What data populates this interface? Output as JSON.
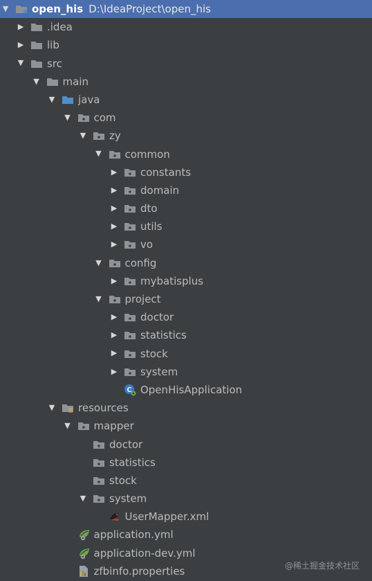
{
  "project": {
    "name": "open_his",
    "path": "D:\\IdeaProject\\open_his"
  },
  "tree": [
    {
      "label": ".idea",
      "name": "tree-item-idea",
      "indent": 0,
      "expanded": false,
      "icon": "folder-icon"
    },
    {
      "label": "lib",
      "name": "tree-item-lib",
      "indent": 0,
      "expanded": false,
      "icon": "folder-icon"
    },
    {
      "label": "src",
      "name": "tree-item-src",
      "indent": 0,
      "expanded": true,
      "icon": "folder-icon"
    },
    {
      "label": "main",
      "name": "tree-item-main",
      "indent": 1,
      "expanded": true,
      "icon": "folder-icon"
    },
    {
      "label": "java",
      "name": "tree-item-java",
      "indent": 2,
      "expanded": true,
      "icon": "source-folder-icon"
    },
    {
      "label": "com",
      "name": "tree-item-com",
      "indent": 3,
      "expanded": true,
      "icon": "package-icon"
    },
    {
      "label": "zy",
      "name": "tree-item-zy",
      "indent": 4,
      "expanded": true,
      "icon": "package-icon"
    },
    {
      "label": "common",
      "name": "tree-item-common",
      "indent": 5,
      "expanded": true,
      "icon": "package-icon"
    },
    {
      "label": "constants",
      "name": "tree-item-constants",
      "indent": 6,
      "expanded": false,
      "icon": "package-icon"
    },
    {
      "label": "domain",
      "name": "tree-item-domain",
      "indent": 6,
      "expanded": false,
      "icon": "package-icon"
    },
    {
      "label": "dto",
      "name": "tree-item-dto",
      "indent": 6,
      "expanded": false,
      "icon": "package-icon"
    },
    {
      "label": "utils",
      "name": "tree-item-utils",
      "indent": 6,
      "expanded": false,
      "icon": "package-icon"
    },
    {
      "label": "vo",
      "name": "tree-item-vo",
      "indent": 6,
      "expanded": false,
      "icon": "package-icon"
    },
    {
      "label": "config",
      "name": "tree-item-config",
      "indent": 5,
      "expanded": true,
      "icon": "package-icon"
    },
    {
      "label": "mybatisplus",
      "name": "tree-item-mybatisplus",
      "indent": 6,
      "expanded": false,
      "icon": "package-icon"
    },
    {
      "label": "project",
      "name": "tree-item-project",
      "indent": 5,
      "expanded": true,
      "icon": "package-icon"
    },
    {
      "label": "doctor",
      "name": "tree-item-project-doctor",
      "indent": 6,
      "expanded": false,
      "icon": "package-icon"
    },
    {
      "label": "statistics",
      "name": "tree-item-project-statistics",
      "indent": 6,
      "expanded": false,
      "icon": "package-icon"
    },
    {
      "label": "stock",
      "name": "tree-item-project-stock",
      "indent": 6,
      "expanded": false,
      "icon": "package-icon"
    },
    {
      "label": "system",
      "name": "tree-item-project-system",
      "indent": 6,
      "expanded": false,
      "icon": "package-icon"
    },
    {
      "label": "OpenHisApplication",
      "name": "tree-item-openhisapplication",
      "indent": 6,
      "expanded": null,
      "icon": "spring-boot-class-icon"
    },
    {
      "label": "resources",
      "name": "tree-item-resources",
      "indent": 2,
      "expanded": true,
      "icon": "resources-folder-icon"
    },
    {
      "label": "mapper",
      "name": "tree-item-mapper",
      "indent": 3,
      "expanded": true,
      "icon": "package-icon"
    },
    {
      "label": "doctor",
      "name": "tree-item-mapper-doctor",
      "indent": 4,
      "expanded": null,
      "icon": "package-icon"
    },
    {
      "label": "statistics",
      "name": "tree-item-mapper-statistics",
      "indent": 4,
      "expanded": null,
      "icon": "package-icon"
    },
    {
      "label": "stock",
      "name": "tree-item-mapper-stock",
      "indent": 4,
      "expanded": null,
      "icon": "package-icon"
    },
    {
      "label": "system",
      "name": "tree-item-mapper-system",
      "indent": 4,
      "expanded": true,
      "icon": "package-icon"
    },
    {
      "label": "UserMapper.xml",
      "name": "tree-item-usermapper-xml",
      "indent": 5,
      "expanded": null,
      "icon": "mybatis-xml-icon"
    },
    {
      "label": "application.yml",
      "name": "tree-item-application-yml",
      "indent": 3,
      "expanded": null,
      "icon": "spring-yml-icon"
    },
    {
      "label": "application-dev.yml",
      "name": "tree-item-application-dev-yml",
      "indent": 3,
      "expanded": null,
      "icon": "spring-yml-icon"
    },
    {
      "label": "zfbinfo.properties",
      "name": "tree-item-zfbinfo-properties",
      "indent": 3,
      "expanded": null,
      "icon": "properties-file-icon"
    }
  ],
  "watermark": "@稀土掘金技术社区",
  "colors": {
    "background": "#3c3f41",
    "selection": "#4b6eaf",
    "folder": "#8f9397",
    "source_folder": "#4e8fc7",
    "spring_green": "#6da54b"
  }
}
